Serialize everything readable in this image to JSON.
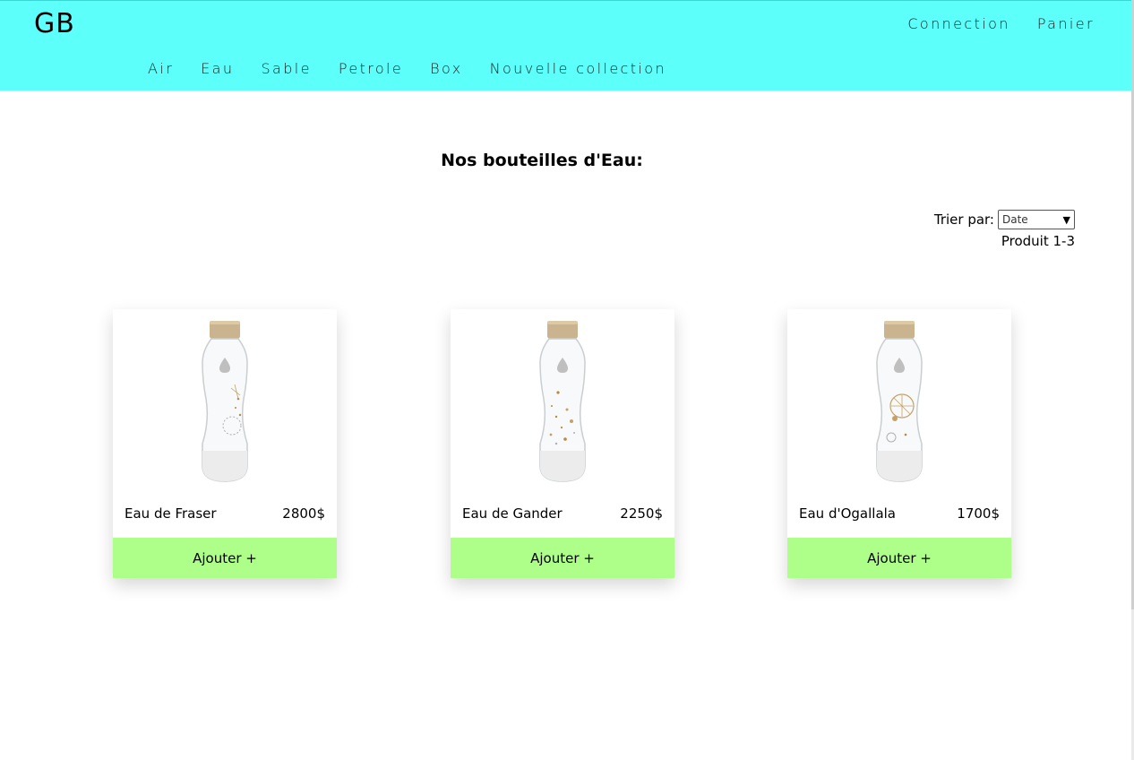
{
  "header": {
    "logo": "GB",
    "top_links": [
      {
        "label": "Connection"
      },
      {
        "label": "Panier"
      }
    ],
    "nav": [
      {
        "label": "Air"
      },
      {
        "label": "Eau"
      },
      {
        "label": "Sable"
      },
      {
        "label": "Petrole"
      },
      {
        "label": "Box"
      },
      {
        "label": "Nouvelle collection"
      }
    ]
  },
  "main": {
    "title": "Nos bouteilles d'Eau:",
    "sort": {
      "label": "Trier par:",
      "selected": "Date"
    },
    "product_count": "Produit 1-3",
    "products": [
      {
        "name": "Eau de Fraser",
        "price": "2800$",
        "button": "Ajouter +"
      },
      {
        "name": "Eau de Gander",
        "price": "2250$",
        "button": "Ajouter +"
      },
      {
        "name": "Eau d'Ogallala",
        "price": "1700$",
        "button": "Ajouter +"
      }
    ]
  },
  "colors": {
    "header_bg": "#5cfffa",
    "button_bg": "#adff8a"
  }
}
